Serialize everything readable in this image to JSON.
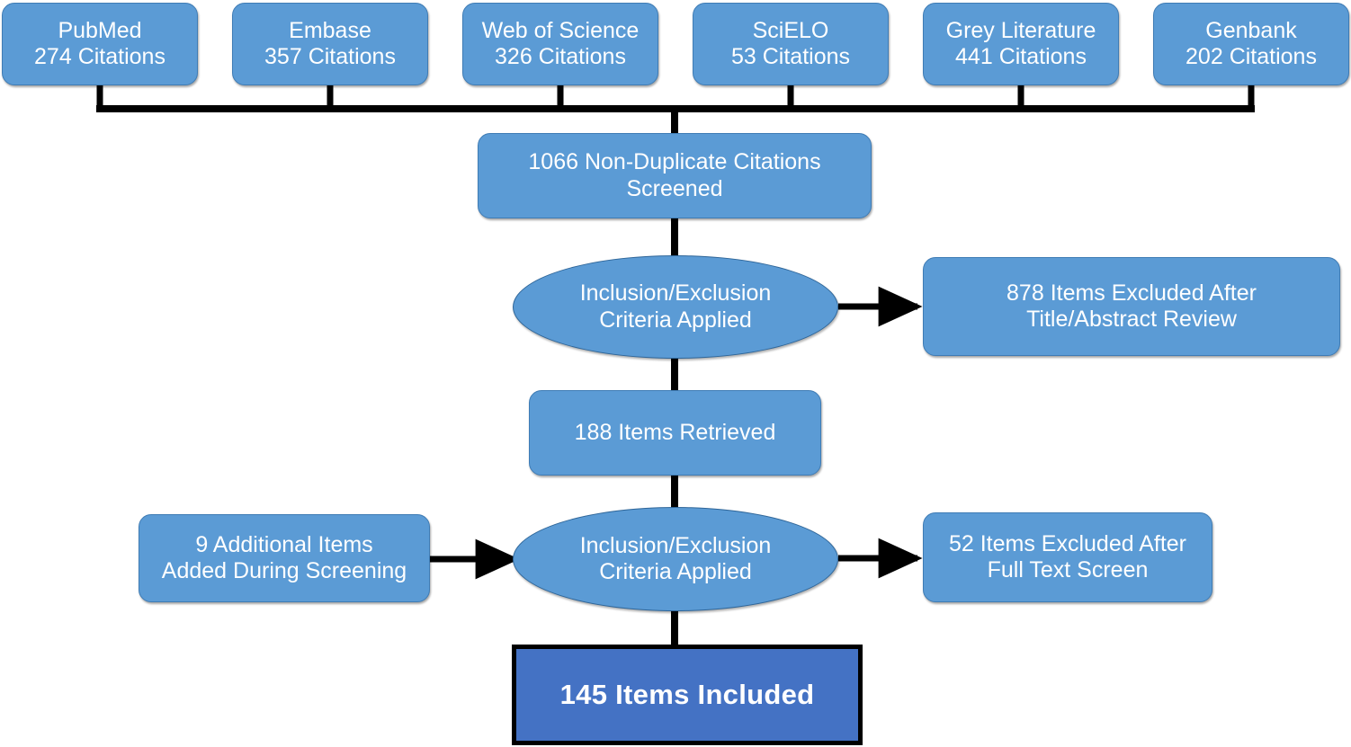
{
  "diagram": {
    "title": "Literature screening flow diagram",
    "colors": {
      "box_fill": "#5B9BD5",
      "terminal_fill": "#4472C4",
      "connector": "#000000",
      "text": "#FFFFFF",
      "background": "#FFFFFF"
    },
    "sources": [
      {
        "name": "PubMed",
        "count": "274",
        "label": "PubMed\n274 Citations"
      },
      {
        "name": "Embase",
        "count": "357",
        "label": "Embase\n357 Citations"
      },
      {
        "name": "Web of Science",
        "count": "326",
        "label": "Web of Science\n326 Citations"
      },
      {
        "name": "SciELO",
        "count": "53",
        "label": "SciELO\n53 Citations"
      },
      {
        "name": "Grey Literature",
        "count": "441",
        "label": "Grey Literature\n441 Citations"
      },
      {
        "name": "Genbank",
        "count": "202",
        "label": "Genbank\n202 Citations"
      }
    ],
    "stages": {
      "screened": {
        "label": "1066 Non-Duplicate Citations\nScreened",
        "count": "1066"
      },
      "criteria1": {
        "label": "Inclusion/Exclusion\nCriteria Applied"
      },
      "excluded1": {
        "label": "878 Items Excluded After\nTitle/Abstract Review",
        "count": "878"
      },
      "retrieved": {
        "label": "188 Items Retrieved",
        "count": "188"
      },
      "added": {
        "label": "9 Additional Items\nAdded During Screening",
        "count": "9"
      },
      "criteria2": {
        "label": "Inclusion/Exclusion\nCriteria Applied"
      },
      "excluded2": {
        "label": "52 Items Excluded After\nFull Text Screen",
        "count": "52"
      },
      "included": {
        "label": "145 Items Included",
        "count": "145"
      }
    }
  },
  "chart_data": {
    "type": "diagram",
    "title": "PRISMA-style literature screening flow",
    "nodes": [
      {
        "id": "pubmed",
        "text": "PubMed 274 Citations",
        "value": 274,
        "shape": "rounded-rect"
      },
      {
        "id": "embase",
        "text": "Embase 357 Citations",
        "value": 357,
        "shape": "rounded-rect"
      },
      {
        "id": "wos",
        "text": "Web of Science 326 Citations",
        "value": 326,
        "shape": "rounded-rect"
      },
      {
        "id": "scielo",
        "text": "SciELO 53 Citations",
        "value": 53,
        "shape": "rounded-rect"
      },
      {
        "id": "grey",
        "text": "Grey Literature 441 Citations",
        "value": 441,
        "shape": "rounded-rect"
      },
      {
        "id": "genbank",
        "text": "Genbank 202 Citations",
        "value": 202,
        "shape": "rounded-rect"
      },
      {
        "id": "screened",
        "text": "1066 Non-Duplicate Citations Screened",
        "value": 1066,
        "shape": "rounded-rect"
      },
      {
        "id": "criteria1",
        "text": "Inclusion/Exclusion Criteria Applied",
        "value": null,
        "shape": "ellipse"
      },
      {
        "id": "excluded1",
        "text": "878 Items Excluded After Title/Abstract Review",
        "value": 878,
        "shape": "rounded-rect"
      },
      {
        "id": "retrieved",
        "text": "188 Items Retrieved",
        "value": 188,
        "shape": "rounded-rect"
      },
      {
        "id": "added",
        "text": "9 Additional Items Added During Screening",
        "value": 9,
        "shape": "rounded-rect"
      },
      {
        "id": "criteria2",
        "text": "Inclusion/Exclusion Criteria Applied",
        "value": null,
        "shape": "ellipse"
      },
      {
        "id": "excluded2",
        "text": "52 Items Excluded After Full Text Screen",
        "value": 52,
        "shape": "rounded-rect"
      },
      {
        "id": "included",
        "text": "145 Items Included",
        "value": 145,
        "shape": "rect"
      }
    ],
    "edges": [
      {
        "from": "pubmed",
        "to": "screened",
        "arrow": false
      },
      {
        "from": "embase",
        "to": "screened",
        "arrow": false
      },
      {
        "from": "wos",
        "to": "screened",
        "arrow": false
      },
      {
        "from": "scielo",
        "to": "screened",
        "arrow": false
      },
      {
        "from": "grey",
        "to": "screened",
        "arrow": false
      },
      {
        "from": "genbank",
        "to": "screened",
        "arrow": false
      },
      {
        "from": "screened",
        "to": "criteria1",
        "arrow": false
      },
      {
        "from": "criteria1",
        "to": "excluded1",
        "arrow": true
      },
      {
        "from": "criteria1",
        "to": "retrieved",
        "arrow": false
      },
      {
        "from": "retrieved",
        "to": "criteria2",
        "arrow": false
      },
      {
        "from": "added",
        "to": "criteria2",
        "arrow": true
      },
      {
        "from": "criteria2",
        "to": "excluded2",
        "arrow": true
      },
      {
        "from": "criteria2",
        "to": "included",
        "arrow": false
      }
    ]
  }
}
